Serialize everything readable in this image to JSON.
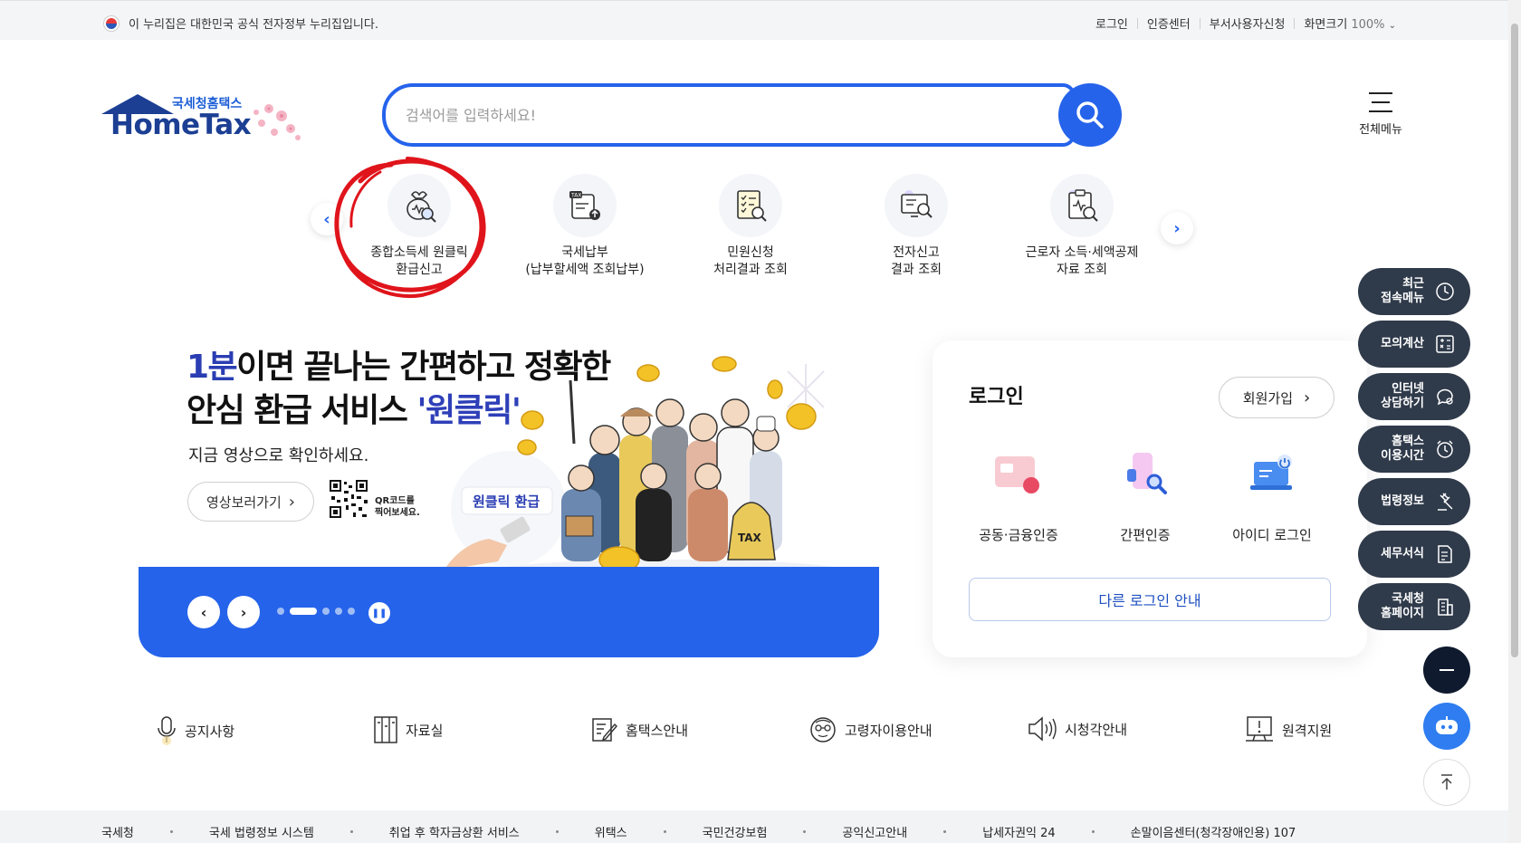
{
  "gov_bar": {
    "notice": "이 누리집은 대한민국 공식 전자정부 누리집입니다."
  },
  "top_links": {
    "login": "로그인",
    "cert_center": "인증센터",
    "dept_user": "부서사용자신청",
    "zoom_label": "화면크기",
    "zoom_value": "100%"
  },
  "logo": {
    "sub": "국세청홈택스",
    "main": "HomeTax"
  },
  "search": {
    "placeholder": "검색어를 입력하세요!"
  },
  "all_menu": {
    "label": "전체메뉴"
  },
  "quick_services": [
    {
      "line1": "종합소득세 원클릭",
      "line2": "환급신고"
    },
    {
      "line1": "국세납부",
      "line2": "(납부할세액 조회납부)"
    },
    {
      "line1": "민원신청",
      "line2": "처리결과 조회"
    },
    {
      "line1": "전자신고",
      "line2": "결과 조회"
    },
    {
      "line1": "근로자 소득·세액공제",
      "line2": "자료 조회"
    }
  ],
  "banner": {
    "title_num": "1분",
    "title_rest1": "이면 끝나는 간편하고 정확한",
    "title_line2a": "안심 환급 서비스 ",
    "title_line2b": "'원클릭'",
    "subtitle": "지금 영상으로 확인하세요.",
    "video_button": "영상보러가기",
    "qr_text1": "QR코드를",
    "qr_text2": "찍어보세요.",
    "badge": "원클릭 환급",
    "sack": "TAX",
    "slide_index": 2,
    "slide_count": 5
  },
  "login_panel": {
    "title": "로그인",
    "join": "회원가입",
    "options": [
      "공동·금융인증",
      "간편인증",
      "아이디 로그인"
    ],
    "other": "다른 로그인 안내"
  },
  "floating_menu": [
    {
      "l1": "최근",
      "l2": "접속메뉴",
      "icon": "clock-icon"
    },
    {
      "l1": "모의계산",
      "l2": "",
      "icon": "calculator-icon"
    },
    {
      "l1": "인터넷",
      "l2": "상담하기",
      "icon": "chat-icon"
    },
    {
      "l1": "홈택스",
      "l2": "이용시간",
      "icon": "alarm-icon"
    },
    {
      "l1": "법령정보",
      "l2": "",
      "icon": "gavel-icon"
    },
    {
      "l1": "세무서식",
      "l2": "",
      "icon": "form-icon"
    },
    {
      "l1": "국세청",
      "l2": "홈페이지",
      "icon": "building-icon"
    }
  ],
  "bottom_links": [
    "공지사항",
    "자료실",
    "홈택스안내",
    "고령자이용안내",
    "시청각안내",
    "원격지원"
  ],
  "footer_links": [
    "국세청",
    "국세 법령정보 시스템",
    "취업 후 학자금상환 서비스",
    "위택스",
    "국민건강보험",
    "공익신고안내",
    "납세자권익 24",
    "손말이음센터(청각장애인용) 107"
  ],
  "colors": {
    "primary": "#2563eb",
    "navy": "#1c3f94",
    "floating": "#2f3a4a",
    "annotation": "#e0141b"
  }
}
